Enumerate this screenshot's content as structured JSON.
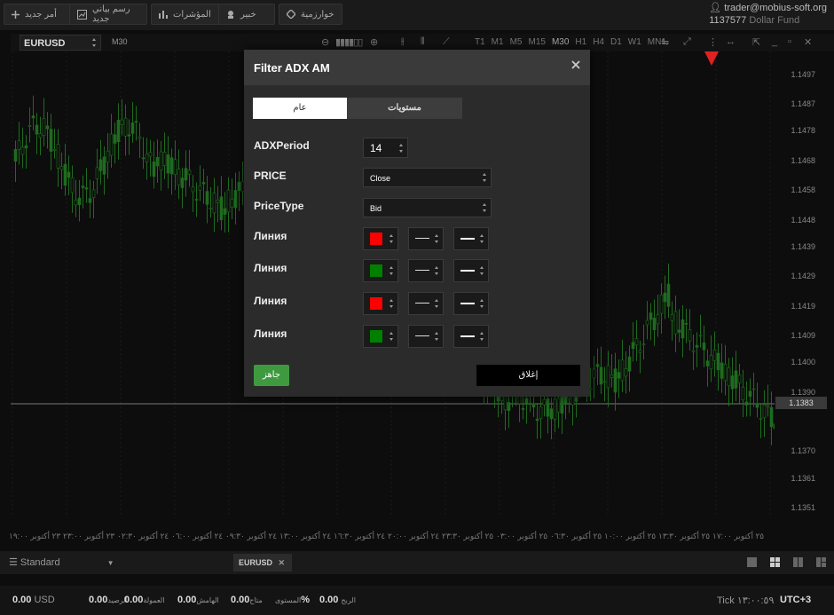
{
  "toolbar": {
    "buttons": [
      {
        "label": "أمر جديد",
        "icon": "plus-icon"
      },
      {
        "label": "رسم بياني جديد",
        "icon": "chart-icon"
      },
      {
        "label": "المؤشرات",
        "icon": "indicators-icon"
      },
      {
        "label": "خبير",
        "icon": "expert-icon"
      },
      {
        "label": "خوارزمية",
        "icon": "diamond-icon"
      }
    ],
    "account_email": "trader@mobius-soft.org",
    "account_number": "1137577",
    "account_fund": "Dollar Fund"
  },
  "chart_header": {
    "symbol": "EURUSD",
    "timeframe_label": "M30",
    "timeframes": [
      "T1",
      "M1",
      "M5",
      "M15",
      "M30",
      "H1",
      "H4",
      "D1",
      "W1",
      "MN1"
    ],
    "active_timeframe": "M30"
  },
  "chart_data": {
    "type": "candlestick",
    "yticks": [
      "1.1497",
      "1.1487",
      "1.1478",
      "1.1468",
      "1.1458",
      "1.1448",
      "1.1439",
      "1.1429",
      "1.1419",
      "1.1409",
      "1.1400",
      "1.1390",
      "1.1383",
      "1.1370",
      "1.1361",
      "1.1351"
    ],
    "ylim": [
      1.1345,
      1.1505
    ],
    "current_price": "1.1383",
    "xticks": [
      "٢٣ أكتوبر ١٩:٠٠",
      "٢٣ أكتوبر ٢٣:٠٠",
      "٢٤ أكتوبر ٠٢:٣٠",
      "٢٤ أكتوبر ٠٦:٠٠",
      "٢٤ أكتوبر ٠٩:٣٠",
      "٢٤ أكتوبر ١٣:٠٠",
      "٢٤ أكتوبر ١٦:٣٠",
      "٢٤ أكتوبر ٢٠:٠٠",
      "٢٥ أكتوبر ٢٣:٣٠",
      "٢٥ أكتوبر ٠٣:٠٠",
      "٢٥ أكتوبر ٠٦:٣٠",
      "٢٥ أكتوبر ١٠:٠٠",
      "٢٥ أكتوبر ١٣:٣٠",
      "٢٥ أكتوبر ١٧:٠٠"
    ],
    "candle_color": "#1f6b1f"
  },
  "dialog": {
    "title": "Filter ADX AM",
    "tab_general": "عام",
    "tab_levels": "مستويات",
    "params": [
      {
        "label": "ADXPeriod",
        "value": "14"
      },
      {
        "label": "PRICE",
        "value": "Close"
      },
      {
        "label": "PriceType",
        "value": "Bid"
      }
    ],
    "lines": [
      {
        "label": "Линия",
        "color": "#ff0000"
      },
      {
        "label": "Линия",
        "color": "#008000"
      },
      {
        "label": "Линия",
        "color": "#ff0000"
      },
      {
        "label": "Линия",
        "color": "#008000"
      }
    ],
    "ok_label": "جاهز",
    "close_label": "إغلاق"
  },
  "bottom_tabs": {
    "workspace": "Standard",
    "symbol_tab": "EURUSD"
  },
  "footer": {
    "items": [
      {
        "value": "0.00",
        "label": "USD"
      },
      {
        "value": "0.00",
        "label": "الرصيد"
      },
      {
        "value": "0.00",
        "label": "العمولة"
      },
      {
        "value": "0.00",
        "label": "الهامش"
      },
      {
        "value": "0.00",
        "label": "متاح"
      },
      {
        "value": "%",
        "label": "المستوى"
      },
      {
        "value": "0.00",
        "label": "الربح"
      }
    ],
    "tick": "Tick ١٣:٠٠:٥٩",
    "timezone": "UTC+3"
  }
}
